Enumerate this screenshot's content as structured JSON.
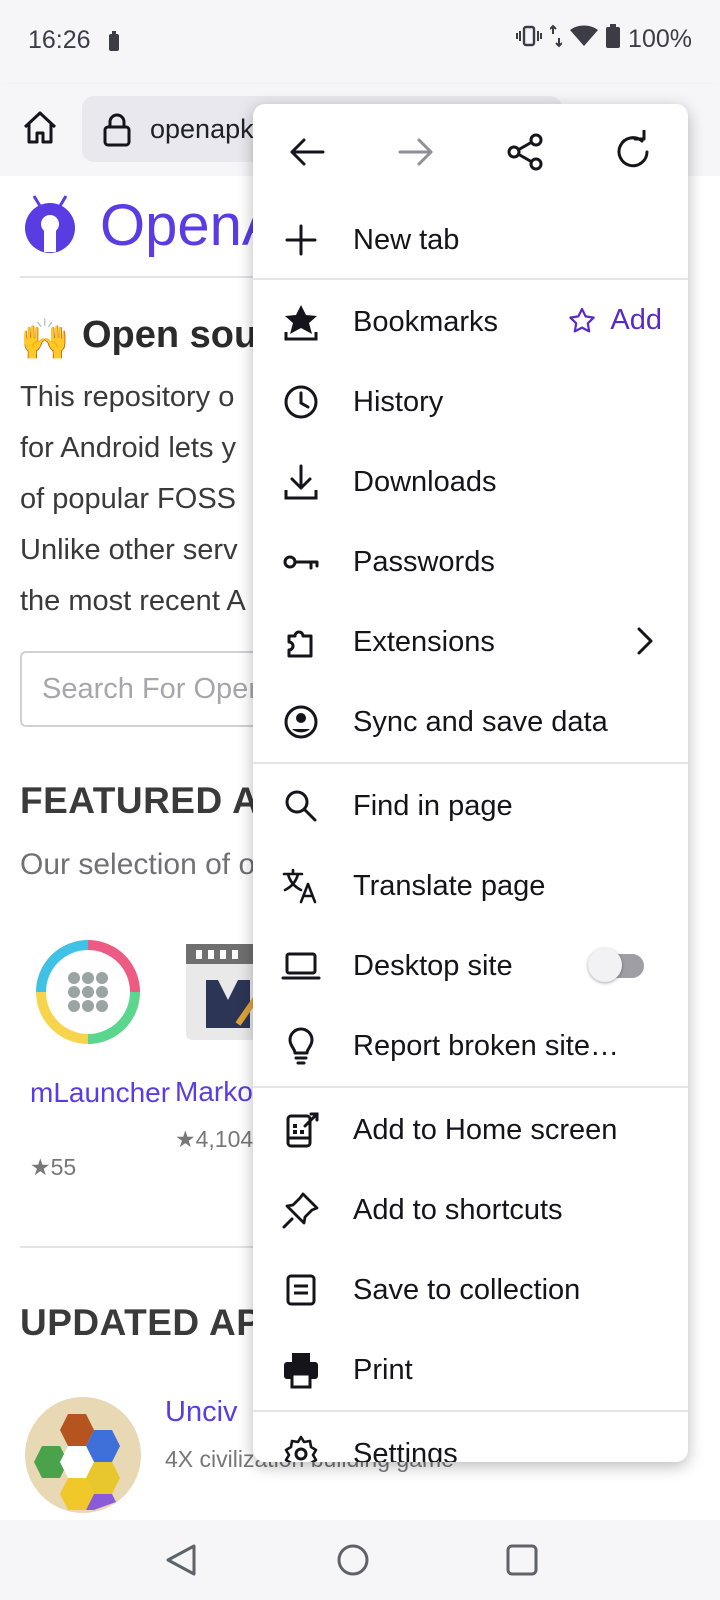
{
  "status": {
    "time": "16:26",
    "battery": "100%"
  },
  "toolbar": {
    "url": "openapk"
  },
  "page": {
    "logo_text": "OpenAPK",
    "open_heading": "Open source",
    "intro_lines": [
      "This repository o",
      "for Android lets y",
      "of popular FOSS",
      "Unlike other serv",
      "the most recent A"
    ],
    "search_placeholder": "Search For Open",
    "featured_heading": "FEATURED APPS",
    "featured_sub": "Our selection of o",
    "apps": [
      {
        "name": "mLauncher",
        "stars": "★55"
      },
      {
        "name": "Markor",
        "stars": "★4,104"
      }
    ],
    "updated_heading": "UPDATED APPS",
    "updated_app": {
      "name": "Unciv",
      "desc": "4X civilization building game"
    }
  },
  "menu": {
    "items": {
      "new_tab": "New tab",
      "bookmarks": "Bookmarks",
      "bookmarks_add": "Add",
      "history": "History",
      "downloads": "Downloads",
      "passwords": "Passwords",
      "extensions": "Extensions",
      "sync": "Sync and save data",
      "find": "Find in page",
      "translate": "Translate page",
      "desktop": "Desktop site",
      "report": "Report broken site…",
      "add_home": "Add to Home screen",
      "add_shortcuts": "Add to shortcuts",
      "save_collection": "Save to collection",
      "print": "Print",
      "settings": "Settings"
    },
    "desktop_site_enabled": false
  },
  "colors": {
    "accent": "#592acb",
    "brand": "#5b3ce3",
    "toolbar_bg": "#f6f6f9"
  }
}
